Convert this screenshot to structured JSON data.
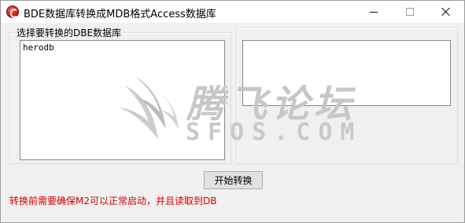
{
  "window": {
    "title": "BDE数据库转换成MDB格式Access数据库"
  },
  "left_group": {
    "label": "选择要转换的DBE数据库",
    "items": [
      "herodb"
    ]
  },
  "right_group": {
    "label": "",
    "items": []
  },
  "actions": {
    "convert_label": "开始转换"
  },
  "warning": {
    "text": "转换前需要确保M2可以正常启动，并且读取到DB"
  },
  "watermark": {
    "title": "腾飞论坛",
    "subtitle": "SFOS.COM"
  },
  "colors": {
    "warning": "#d40000",
    "icon": "#e0261d"
  }
}
